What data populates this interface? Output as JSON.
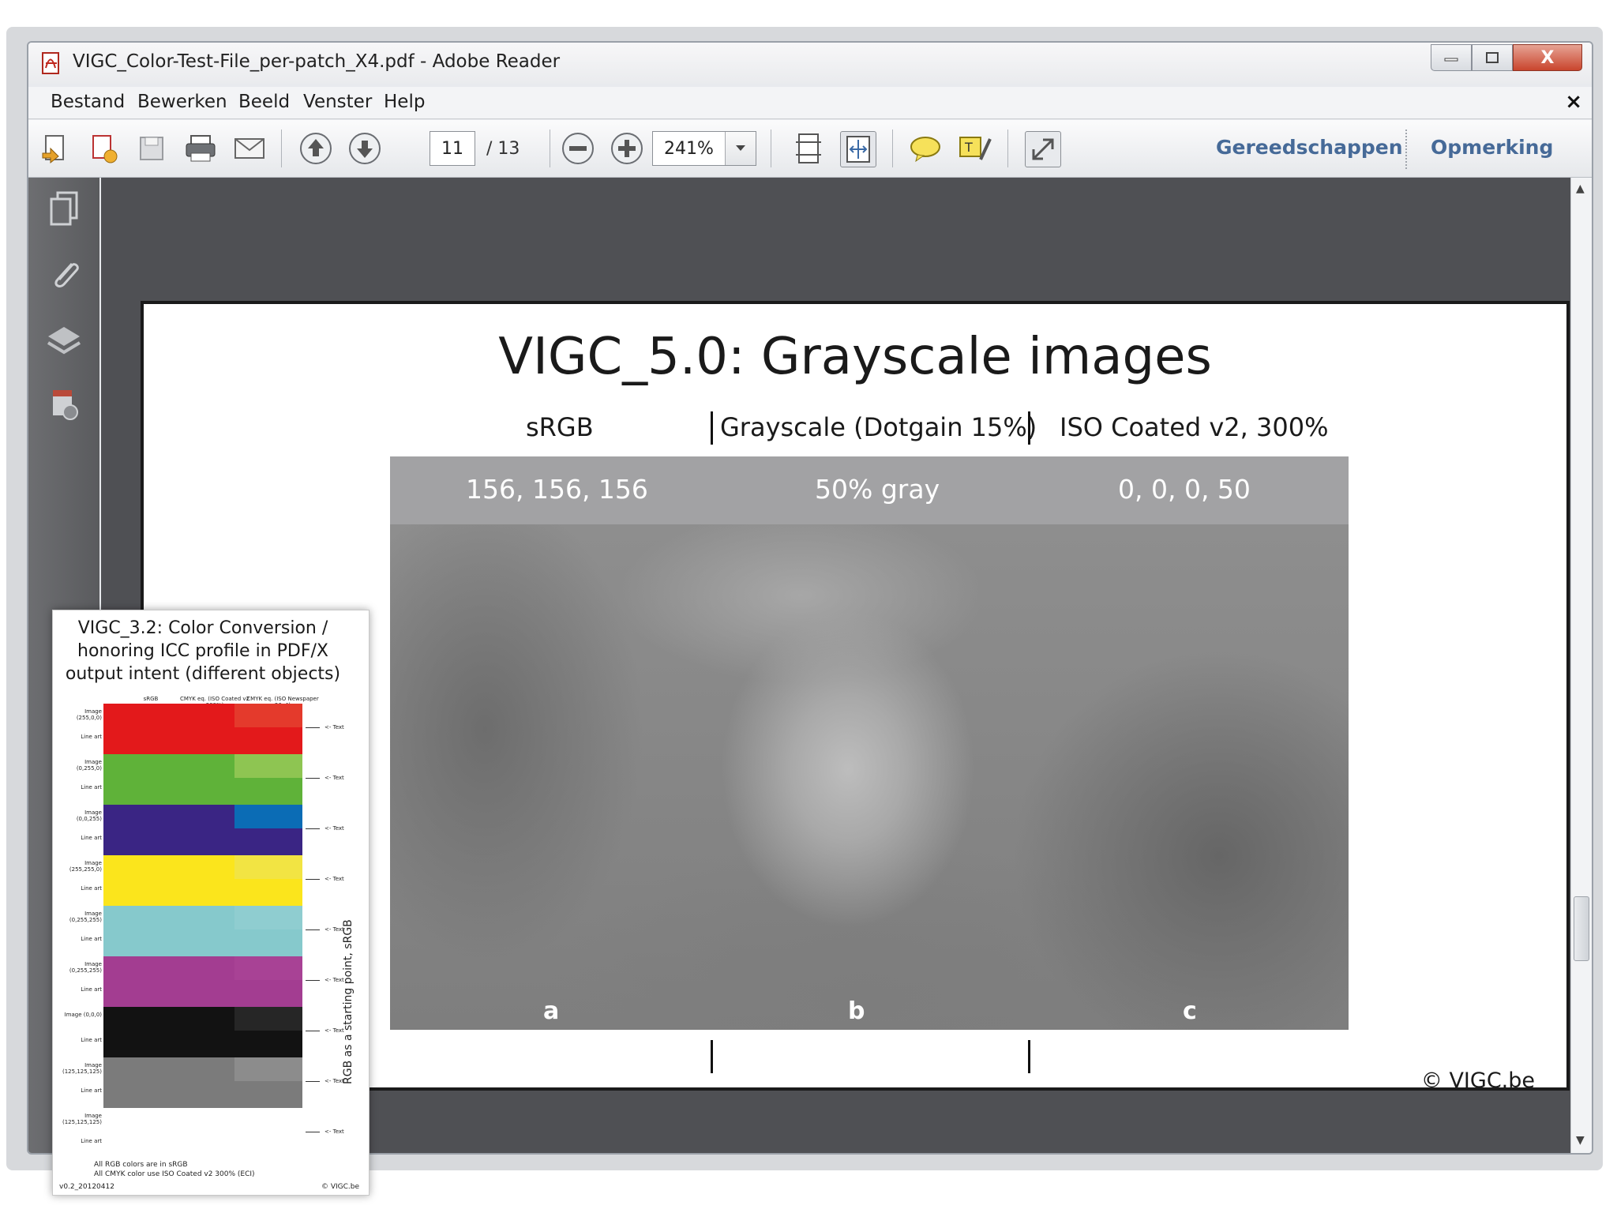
{
  "window": {
    "title": "VIGC_Color-Test-File_per-patch_X4.pdf - Adobe Reader",
    "controls": {
      "minimize": "minimize",
      "maximize": "maximize",
      "close": "X"
    }
  },
  "menu": {
    "items": [
      "Bestand",
      "Bewerken",
      "Beeld",
      "Venster",
      "Help"
    ],
    "close_label": "×"
  },
  "toolbar": {
    "page_current": "11",
    "page_total": "/ 13",
    "zoom": "241%",
    "tools_label": "Gereedschappen",
    "comment_label": "Opmerking",
    "icons": [
      "create-pdf-icon",
      "create-pdf-combine-icon",
      "save-icon",
      "print-icon",
      "email-icon",
      "previous-page-icon",
      "next-page-icon",
      "zoom-out-icon",
      "zoom-in-icon",
      "fit-page-icon",
      "fit-width-icon",
      "comment-icon",
      "highlight-icon",
      "fullscreen-icon"
    ]
  },
  "left_panel": {
    "icons": [
      "pages-icon",
      "attachments-icon",
      "layers-icon",
      "security-icon"
    ]
  },
  "document": {
    "title": "VIGC_5.0: Grayscale images",
    "columns": [
      "sRGB",
      "Grayscale (Dotgain 15%)",
      "ISO Coated v2, 300%"
    ],
    "values": [
      "156, 156, 156",
      "50% gray",
      "0, 0, 0, 50"
    ],
    "labels": [
      "a",
      "b",
      "c"
    ],
    "copyright": "© VIGC.be"
  },
  "thumbnail": {
    "title_lines": [
      "VIGC_3.2: Color Conversion /",
      "honoring ICC profile in PDF/X",
      "output intent (different objects)"
    ],
    "col_heads": [
      "sRGB",
      "CMYK eq. (ISO Coated v2 300%)",
      "CMYK eq. (ISO Newspaper 26v4)"
    ],
    "rows": [
      {
        "label": "Image (255,0,0)",
        "color": "#e3191b",
        "alt": "#e43a2c"
      },
      {
        "label": "Image (0,255,0)",
        "color": "#5fb239",
        "alt": "#8ec552"
      },
      {
        "label": "Image (0,0,255)",
        "color": "#3a2584",
        "alt": "#0b6cb5"
      },
      {
        "label": "Image (255,255,0)",
        "color": "#fbe51c",
        "alt": "#f2e443"
      },
      {
        "label": "Image (0,255,255)",
        "color": "#86c9cc",
        "alt": "#8fcdd0"
      },
      {
        "label": "Image (0,255,255)",
        "color": "#a33d91",
        "alt": "#a84295"
      },
      {
        "label": "Image (0,0,0)",
        "color": "#121212",
        "alt": "#262626"
      },
      {
        "label": "Image (125,125,125)",
        "color": "#7b7b7b",
        "alt": "#8c8c8c"
      },
      {
        "label": "Image (125,125,125)",
        "color": "#ffffff",
        "alt": "#ffffff"
      }
    ],
    "row_sublabel": "Line art",
    "text_label": "<- Text",
    "foot_lines": [
      "All RGB colors are in sRGB",
      "All CMYK color use ISO Coated v2 300% (ECI)"
    ],
    "version": "v0.2_20120412",
    "footer_right": "© VIGC.be",
    "vertical_note": "RGB as a starting point, sRGB"
  }
}
